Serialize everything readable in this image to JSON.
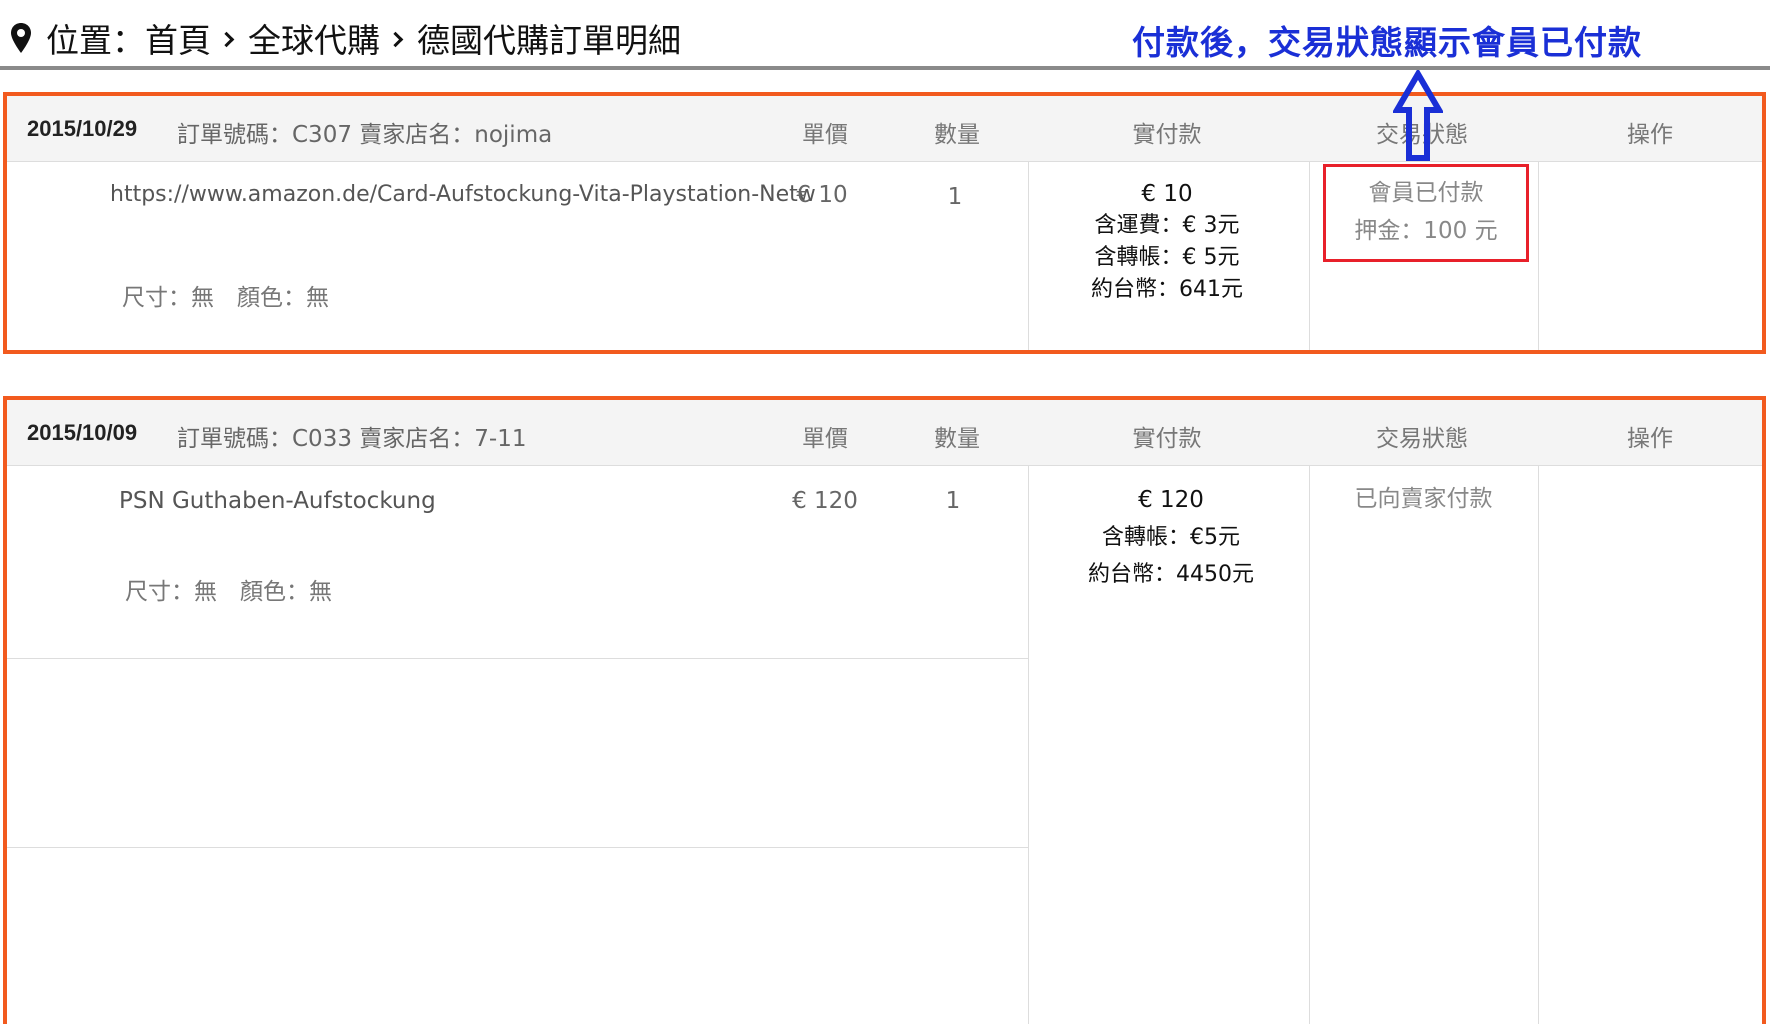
{
  "breadcrumb": {
    "prefix": "位置：首頁",
    "items": [
      "全球代購",
      "德國代購訂單明細"
    ]
  },
  "annotation": "付款後，交易狀態顯示會員已付款",
  "columns": {
    "price": "單價",
    "qty": "數量",
    "paid": "實付款",
    "status": "交易狀態",
    "action": "操作"
  },
  "orders": [
    {
      "date": "2015/10/29",
      "info": "訂單號碼：C307 賣家店名：nojima",
      "product": "https://www.amazon.de/Card-Aufstockung-Vita-Playstation-Netw",
      "options": "尺寸：無　顏色：無",
      "price": "€ 10",
      "qty": "1",
      "paid_lines": [
        "€ 10",
        "含運費：€ 3元",
        "含轉帳：€ 5元",
        "約台幣：641元"
      ],
      "status_lines": [
        "會員已付款",
        "押金：100 元"
      ]
    },
    {
      "date": "2015/10/09",
      "info": "訂單號碼：C033 賣家店名：7-11",
      "product": "PSN Guthaben-Aufstockung",
      "options": "尺寸：無　顏色：無",
      "price": "€ 120",
      "qty": "1",
      "paid_lines": [
        "€ 120",
        "含轉帳：€5元",
        "約台幣：4450元"
      ],
      "status_lines": [
        "已向賣家付款"
      ]
    }
  ],
  "colors": {
    "order_border": "#f25a1e",
    "annotation": "#1a2fd6",
    "highlight_box": "#e8202a"
  },
  "icons": [
    "location-pin-icon",
    "chevron-right-icon",
    "up-arrow-icon"
  ]
}
